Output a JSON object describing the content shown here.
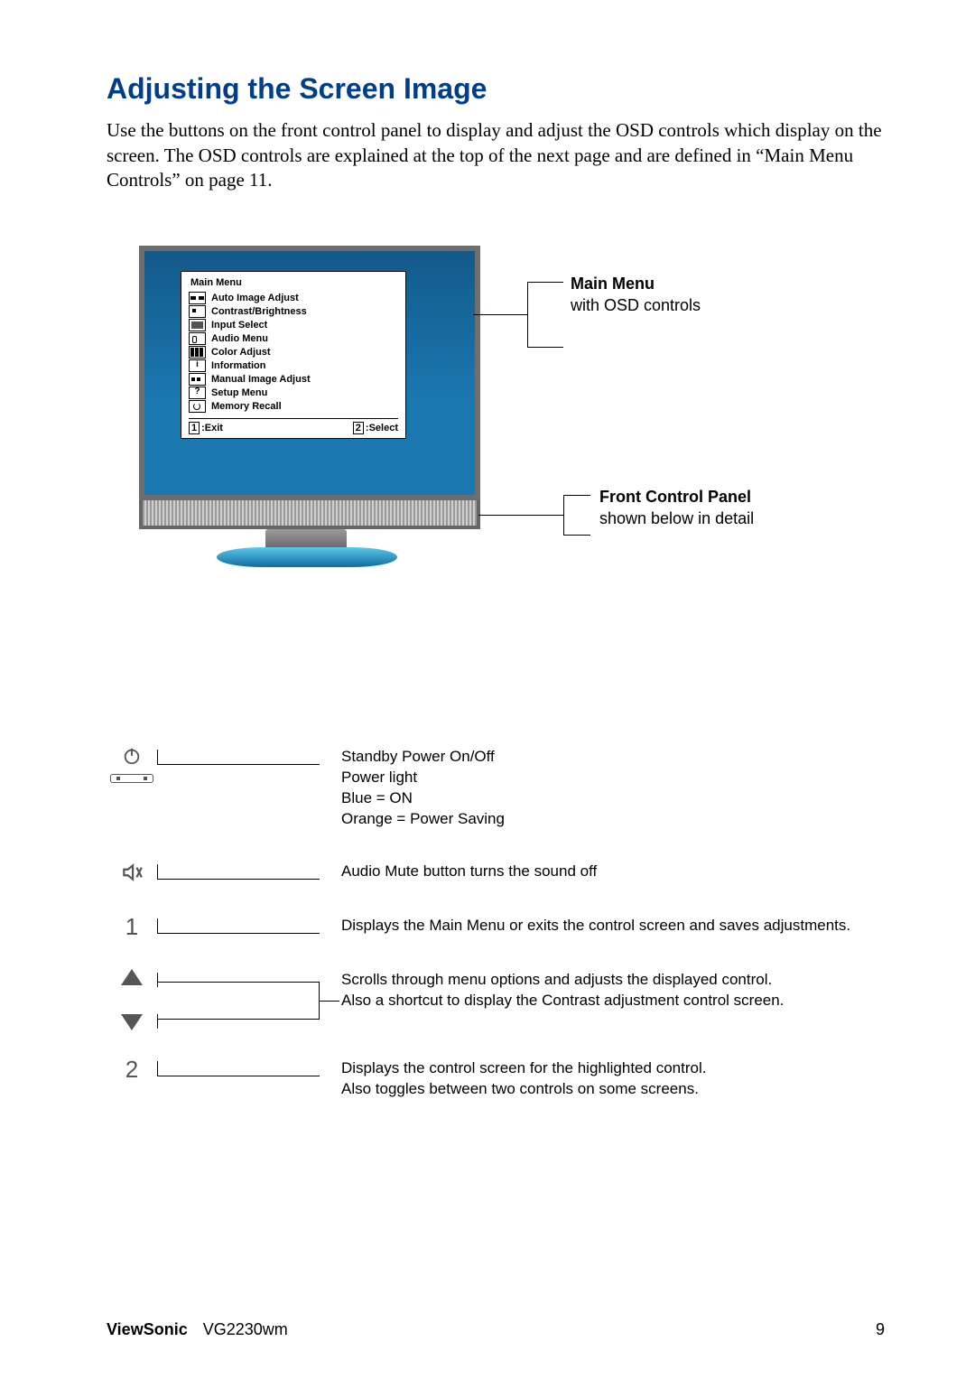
{
  "title": "Adjusting the Screen Image",
  "intro": "Use the buttons on the front control panel to display and adjust the OSD controls which display on the screen. The OSD controls are explained at the top of the next page and are defined in “Main Menu Controls” on page 11.",
  "osd": {
    "title": "Main Menu",
    "items": [
      "Auto Image Adjust",
      "Contrast/Brightness",
      "Input Select",
      "Audio Menu",
      "Color Adjust",
      "Information",
      "Manual Image Adjust",
      "Setup Menu",
      "Memory Recall"
    ],
    "foot_left_key": "1",
    "foot_left": ":Exit",
    "foot_right_key": "2",
    "foot_right": ":Select"
  },
  "labels": {
    "menu_t": "Main Menu",
    "menu_s": "with OSD controls",
    "panel_t": "Front Control Panel",
    "panel_s": "shown below in detail"
  },
  "legend": {
    "power": [
      "Standby Power On/Off",
      "Power light",
      "Blue = ON",
      "Orange = Power Saving"
    ],
    "mute": "Audio Mute button turns the sound off",
    "b1": "Displays the Main Menu or exits the control screen and saves adjustments.",
    "arrow1": "Scrolls through menu options and adjusts the displayed control.",
    "arrow2": "Also a shortcut to display the Contrast adjustment control screen.",
    "b2a": "Displays the control screen for the highlighted control.",
    "b2b": "Also toggles between two controls on some screens.",
    "n1": "1",
    "n2": "2"
  },
  "footer": {
    "brand": "ViewSonic",
    "model": "VG2230wm",
    "page": "9"
  }
}
